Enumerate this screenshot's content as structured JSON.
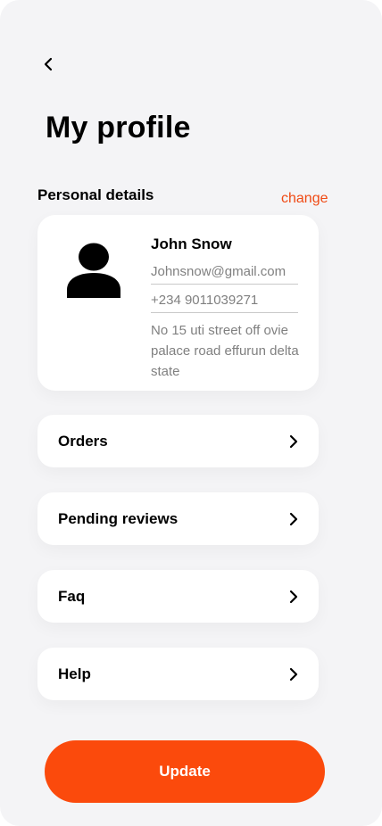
{
  "page": {
    "title": "My profile"
  },
  "icons": {
    "back": "back-chevron-icon",
    "avatar": "person-icon",
    "chevron": "chevron-right-icon"
  },
  "personal_details": {
    "section_title": "Personal details",
    "change_label": "change",
    "name": "John Snow",
    "email": "Johnsnow@gmail.com",
    "phone": "+234 9011039271",
    "address": "No 15 uti street off ovie palace road effurun delta state"
  },
  "menu": {
    "items": [
      {
        "label": "Orders"
      },
      {
        "label": "Pending reviews"
      },
      {
        "label": "Faq"
      },
      {
        "label": "Help"
      }
    ]
  },
  "actions": {
    "update_label": "Update"
  },
  "colors": {
    "accent": "#fb4a0c",
    "link": "#f04a14",
    "background": "#f4f4f6",
    "card": "#ffffff"
  }
}
